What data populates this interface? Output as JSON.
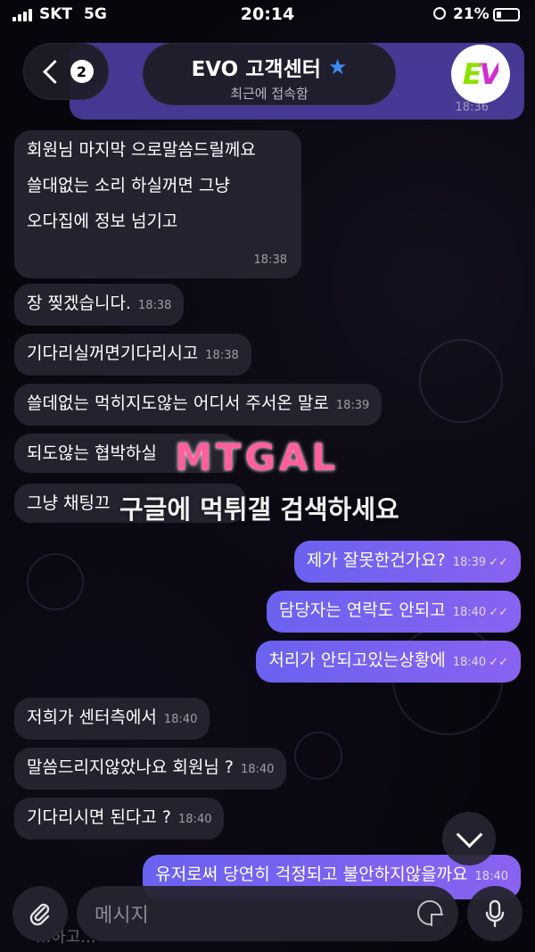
{
  "status_bar": {
    "carrier": "SKT",
    "network": "5G",
    "time": "20:14",
    "battery": "21%"
  },
  "header": {
    "back_count": "2",
    "title": "EVO 고객센터",
    "subtitle": "최근에 접속함",
    "avatar_text": "EV",
    "pinned_time": "18:36"
  },
  "messages": [
    {
      "dir": "in",
      "text": "회원님 마지막 으로말씀드릴께요\n\n쓸대없는 소리 하실꺼면 그냥\n\n오다집에 정보 넘기고",
      "time": "18:38"
    },
    {
      "dir": "in",
      "text": "장 찢겠습니다.",
      "time": "18:38"
    },
    {
      "dir": "in",
      "text": "기다리실꺼면기다리시고",
      "time": "18:38"
    },
    {
      "dir": "in",
      "text": "쓸데없는 먹히지도않는 어디서 주서온 말로",
      "time": "18:39"
    },
    {
      "dir": "in",
      "text": "되도않는 협박하실",
      "time": ""
    },
    {
      "dir": "in",
      "text": "그냥 채팅끄",
      "time": ""
    },
    {
      "dir": "out",
      "text": "제가 잘못한건가요?",
      "time": "18:39"
    },
    {
      "dir": "out",
      "text": "담당자는 연락도 안되고",
      "time": "18:40"
    },
    {
      "dir": "out",
      "text": "처리가 안되고있는상황에",
      "time": "18:40"
    },
    {
      "dir": "in",
      "text": "저희가 센터측에서",
      "time": "18:40"
    },
    {
      "dir": "in",
      "text": "말씀드리지않았나요 회원님 ?",
      "time": "18:40"
    },
    {
      "dir": "in",
      "text": "기다리시면 된다고 ?",
      "time": "18:40"
    },
    {
      "dir": "out",
      "text": "유저로써 당연히 걱정되고 불안하지않을까요",
      "time": "18:40"
    }
  ],
  "watermark": {
    "logo": "MTGAL",
    "text": "구글에 먹튀갤 검색하세요"
  },
  "composer": {
    "placeholder": "메시지",
    "behind_text": "...하고..."
  },
  "colors": {
    "outgoing": "#6a62f0",
    "incoming": "#262430",
    "accent_star": "#3d8af5"
  },
  "icons": [
    "back-chevron-icon",
    "star-icon",
    "chevron-down-icon",
    "paperclip-icon",
    "sticker-icon",
    "microphone-icon",
    "read-checks-icon"
  ]
}
